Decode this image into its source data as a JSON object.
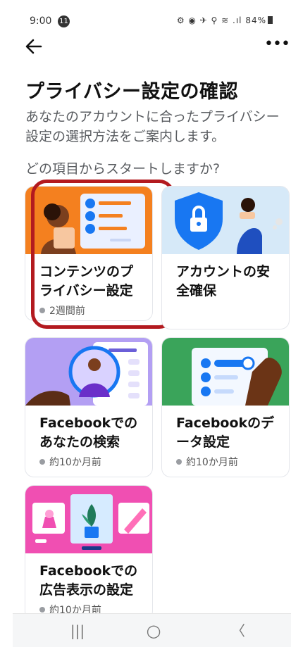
{
  "status_bar": {
    "time": "9:00",
    "notification_count": "11",
    "right_icons": "⚙ ◉ ✈ ⚲ ≋ .ıl",
    "battery": "84%"
  },
  "header": {
    "more_label": "•••"
  },
  "page": {
    "title": "プライバシー設定の確認",
    "description": "あなたのアカウントに合ったプライバシー設定の選択方法をご案内します。",
    "prompt": "どの項目からスタートしますか?"
  },
  "cards": [
    {
      "title": "コンテンツのプライバシー設定",
      "meta": "2週間前",
      "color": "#f4801f",
      "selected": true
    },
    {
      "title": "アカウントの安全確保",
      "meta": "",
      "color": "#d6e9f8"
    },
    {
      "title": "Facebookでのあなたの検索",
      "meta": "約10か月前",
      "color": "#b39ff3"
    },
    {
      "title": "Facebookのデータ設定",
      "meta": "約10か月前",
      "color": "#3aa45a"
    },
    {
      "title": "Facebookでの広告表示の設定",
      "meta": "約10か月前",
      "color": "#f04fb2"
    }
  ],
  "system_nav": {
    "recents": "|||",
    "home": "○",
    "back": "〈"
  }
}
